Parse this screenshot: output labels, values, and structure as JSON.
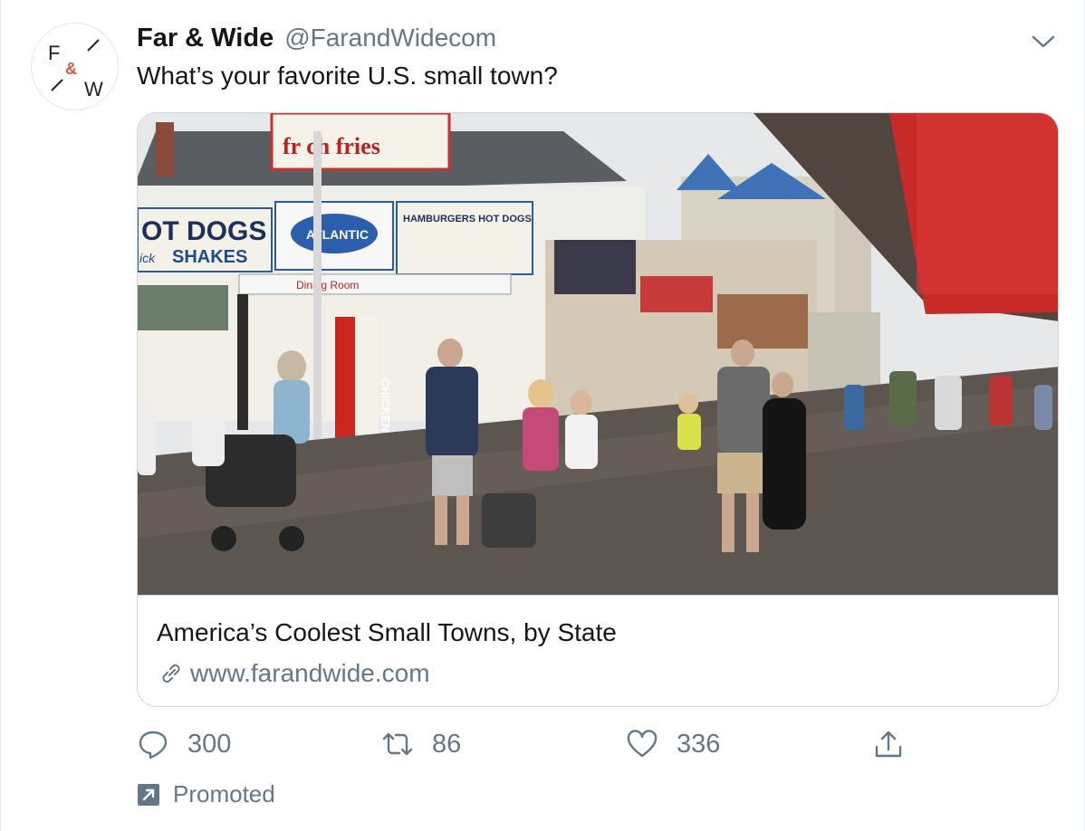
{
  "account": {
    "name": "Far & Wide",
    "handle": "@FarandWidecom",
    "avatar_letters": {
      "top_left": "F",
      "middle": "&",
      "bottom_right": "W"
    }
  },
  "tweet": {
    "text": "What’s your favorite U.S. small town?"
  },
  "card": {
    "image_subject": "boardwalk-crowd-photo",
    "title": "America’s Coolest Small Towns, by State",
    "url": "www.farandwide.com",
    "photo_signs": {
      "hotdogs": "OT DOGS",
      "shakes": "SHAKES",
      "shakes_prefix": "ick",
      "atlantic": "ATLANTIC",
      "hamburgers": "HAMBURGERS  HOT DOGS",
      "fries": "fr ch fries",
      "dining": "Dining Room",
      "chicken": "CHICKEN"
    }
  },
  "actions": {
    "reply_count": "300",
    "retweet_count": "86",
    "like_count": "336"
  },
  "promoted_label": "Promoted",
  "icons": {
    "reply": "reply-icon",
    "retweet": "retweet-icon",
    "like": "heart-icon",
    "share": "share-icon",
    "link": "link-icon",
    "promoted": "promoted-arrow-icon",
    "caret": "chevron-down-icon"
  },
  "colors": {
    "text": "#14171a",
    "secondary": "#657786",
    "border": "#ccd6dd",
    "brand_accent": "#e0533d"
  }
}
